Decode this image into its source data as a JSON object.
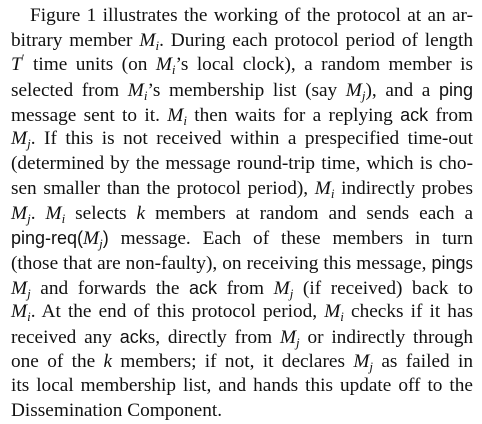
{
  "lines": [
    [
      {
        "t": "text",
        "v": "Figure 1 illustrates the working of the protocol at an ar-"
      }
    ],
    [
      {
        "t": "text",
        "v": "bitrary member "
      },
      {
        "t": "math",
        "v": "M",
        "sub": "i"
      },
      {
        "t": "text",
        "v": ". During each protocol period of length"
      }
    ],
    [
      {
        "t": "math",
        "v": "T",
        "sup": "′"
      },
      {
        "t": "text",
        "v": " time units (on "
      },
      {
        "t": "math",
        "v": "M",
        "sub": "i"
      },
      {
        "t": "text",
        "v": "’s local clock), a random member is"
      }
    ],
    [
      {
        "t": "text",
        "v": "selected from "
      },
      {
        "t": "math",
        "v": "M",
        "sub": "i"
      },
      {
        "t": "text",
        "v": "’s membership list (say "
      },
      {
        "t": "math",
        "v": "M",
        "sub": "j"
      },
      {
        "t": "text",
        "v": "), and a "
      },
      {
        "t": "sans",
        "v": "ping"
      }
    ],
    [
      {
        "t": "text",
        "v": "message sent to it. "
      },
      {
        "t": "math",
        "v": "M",
        "sub": "i"
      },
      {
        "t": "text",
        "v": " then waits for a replying "
      },
      {
        "t": "sans",
        "v": "ack"
      },
      {
        "t": "text",
        "v": " from"
      }
    ],
    [
      {
        "t": "math",
        "v": "M",
        "sub": "j"
      },
      {
        "t": "text",
        "v": ". If this is not received within a prespecified time-out"
      }
    ],
    [
      {
        "t": "text",
        "v": "(determined by the message round-trip time, which is cho-"
      }
    ],
    [
      {
        "t": "text",
        "v": "sen smaller than the protocol period), "
      },
      {
        "t": "math",
        "v": "M",
        "sub": "i"
      },
      {
        "t": "text",
        "v": " indirectly probes"
      }
    ],
    [
      {
        "t": "math",
        "v": "M",
        "sub": "j"
      },
      {
        "t": "text",
        "v": ". "
      },
      {
        "t": "math",
        "v": "M",
        "sub": "i"
      },
      {
        "t": "text",
        "v": " selects "
      },
      {
        "t": "math",
        "v": "k"
      },
      {
        "t": "text",
        "v": " members at random and sends each a"
      }
    ],
    [
      {
        "t": "sans",
        "v": "ping-req("
      },
      {
        "t": "math",
        "v": "M",
        "sub": "j"
      },
      {
        "t": "sans",
        "v": ")"
      },
      {
        "t": "text",
        "v": " message. Each of these members in turn"
      }
    ],
    [
      {
        "t": "text",
        "v": "(those that are non-faulty), on receiving this message, "
      },
      {
        "t": "sans",
        "v": "ping"
      },
      {
        "t": "text",
        "v": "s"
      }
    ],
    [
      {
        "t": "math",
        "v": "M",
        "sub": "j"
      },
      {
        "t": "text",
        "v": " and forwards the "
      },
      {
        "t": "sans",
        "v": "ack"
      },
      {
        "t": "text",
        "v": " from "
      },
      {
        "t": "math",
        "v": "M",
        "sub": "j"
      },
      {
        "t": "text",
        "v": " (if received) back to"
      }
    ],
    [
      {
        "t": "math",
        "v": "M",
        "sub": "i"
      },
      {
        "t": "text",
        "v": ". At the end of this protocol period, "
      },
      {
        "t": "math",
        "v": "M",
        "sub": "i"
      },
      {
        "t": "text",
        "v": " checks if it has"
      }
    ],
    [
      {
        "t": "text",
        "v": "received any "
      },
      {
        "t": "sans",
        "v": "ack"
      },
      {
        "t": "text",
        "v": "s, directly from "
      },
      {
        "t": "math",
        "v": "M",
        "sub": "j"
      },
      {
        "t": "text",
        "v": " or indirectly through"
      }
    ],
    [
      {
        "t": "text",
        "v": "one of the "
      },
      {
        "t": "math",
        "v": "k"
      },
      {
        "t": "text",
        "v": " members; if not, it declares "
      },
      {
        "t": "math",
        "v": "M",
        "sub": "j"
      },
      {
        "t": "text",
        "v": " as failed in"
      }
    ],
    [
      {
        "t": "text",
        "v": "its local membership list, and hands this update off to the"
      }
    ],
    [
      {
        "t": "text",
        "v": "Dissemination Component."
      }
    ]
  ]
}
